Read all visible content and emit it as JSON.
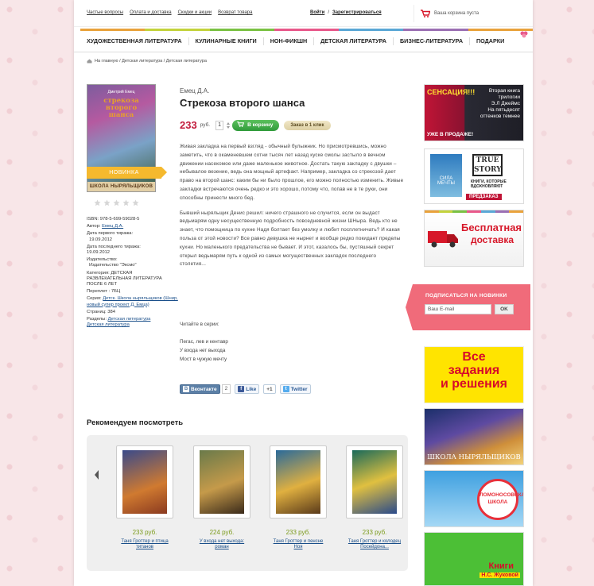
{
  "topbar": {
    "links": [
      "Частые вопросы",
      "Оплата и доставка",
      "Скидки и акции",
      "Возврат товара"
    ],
    "login": "Войти",
    "separator": "/",
    "register": "Зарегистрироваться",
    "cart_text": "Ваша корзина пуста"
  },
  "nav": {
    "items": [
      "ХУДОЖЕСТВЕННАЯ ЛИТЕРАТУРА",
      "КУЛИНАРНЫЕ КНИГИ",
      "НОН-ФИКШН",
      "ДЕТСКАЯ ЛИТЕРАТУРА",
      "БИЗНЕС-ЛИТЕРАТУРА",
      "ПОДАРКИ"
    ],
    "stripe_colors": [
      "#e9a23b",
      "#c3d33c",
      "#7ac143",
      "#e8588a",
      "#5aa7d6",
      "#9b6fb3",
      "#e9a23b"
    ]
  },
  "breadcrumb": "На главную / Детская литература / Детская литература",
  "product": {
    "cover_author": "Дмитрий Емец",
    "cover_title": "стрекоза второго шанса",
    "cover_footer": "ШКОЛА НЫРЯЛЬЩИКОВ",
    "badge": "НОВИНКА",
    "rating": 0,
    "rating_max": 5,
    "author": "Емец Д.А.",
    "title": "Стрекоза второго шанса",
    "price": "233",
    "currency": "руб.",
    "qty": "1",
    "add_to_cart": "В корзину",
    "one_click": "Заказ в 1 клик",
    "meta": {
      "isbn": "ISBN: 978-5-699-59028-5",
      "author_label": "Автор:",
      "author_link": "Емец Д.А.",
      "first_print_label": "Дата первого тиража:",
      "first_print": "19.09.2012",
      "last_print_label": "Дата последнего тиража:",
      "last_print": "19.09.2012",
      "publisher_label": "Издательство:",
      "publisher": "Издательство \"Эксмо\"",
      "category_label": "Категория:",
      "category": "ДЕТСКАЯ РАЗВЛЕКАТЕЛЬНАЯ ЛИТЕРАТУРА ПОСЛЕ 6 ЛЕТ",
      "translator": "Переплет : 7БЦ",
      "series_label": "Серия:",
      "series_link": "Детск. Школа ныряльщиков (Шнир, новый супер проект Д. Емца)",
      "pages": "Страниц: 384",
      "sections_label": "Разделы:",
      "sections_link1": "Детская литература",
      "sections_link2": "Детская литература"
    },
    "description": [
      "Живая закладка на первый взгляд - обычный булыжник. Но присмотревшись, можно заметить, что в окаменевшем сотни тысяч лет назад куске смолы застыло в вечном движении насекомое или даже маленькое животное. Достать такую закладку с двушки – небывалое везение, ведь она мощный артефакт. Например, закладка со стрекозой дает право на второй шанс: каким бы ни было прошлое, его можно полностью изменить. Живые закладки встречаются очень редко и это хорошо, потому что, попав не в те руки, они способны принести много бед.",
      "Бывший ныряльщик Денис решил: ничего страшного не случится, если он выдаст ведьмарям одну несущественную подробность повседневной жизни ШНыра. Ведь кто не знает, что помощница по кухне Надя болтает без умолку и любит посплетничать? И какая польза от этой новости? Все равно девушка не нырнет и вообще редко покидает пределы кухни. Но маленького предательства не бывает. И этот, казалось бы, пустяшный секрет открыл ведьмарям путь к одной из самых могущественных закладок последнего столетия..."
    ],
    "series_intro": "Читайте в серии:",
    "series_list": [
      "Пегас, лев и кентавр",
      "У входа нет выхода",
      "Мост в чужую мечту"
    ]
  },
  "social": {
    "vk": "Вконтакте",
    "vk_count": "2",
    "fb": "Like",
    "gplus": "+1",
    "tw": "Twitter"
  },
  "recommend": {
    "title": "Рекомендуем посмотреть",
    "items": [
      {
        "price": "233 руб.",
        "name": "Таня Гроттер и птица титанов"
      },
      {
        "price": "224 руб.",
        "name": "У входа нет выхода: роман"
      },
      {
        "price": "233 руб.",
        "name": "Таня Гроттер и пенсне Ноя"
      },
      {
        "price": "233 руб.",
        "name": "Таня Гроттер и колодец Посейдона..."
      }
    ]
  },
  "sidebar": {
    "b1": {
      "sens": "СЕНСАЦИЯ!!!",
      "trilogy": "Вторая книга трилогии",
      "author": "Э.Л Джеймс",
      "title": "На пятьдесят оттенков темнее",
      "sale": "УЖЕ В ПРОДАЖЕ!"
    },
    "b2": {
      "book": "СИЛА МЕЧТЫ",
      "ts1": "TRUE",
      "ts2": "STORY",
      "sub": "КНИГИ, КОТОРЫЕ ВДОХНОВЛЯЮТ",
      "pre": "ПРЕДЗАКАЗ"
    },
    "b3": {
      "t1": "Бесплатная",
      "t2": "доставка"
    },
    "subscribe": {
      "label": "ПОДПИСАТЬСЯ НА НОВИНКИ",
      "placeholder": "Ваш E-mail",
      "ok": "OK"
    },
    "b4": {
      "l1": "Все",
      "l2": "задания",
      "l3": "и решения"
    },
    "b5": {
      "text": "ШКОЛА НЫРЯЛЬЩИКОВ"
    },
    "b6": {
      "text": "ЛОМОНОСОВСКАЯ ШКОЛА"
    },
    "b7": {
      "k1": "Книги",
      "k2": "Н.С. Жуковой"
    }
  },
  "colors": {
    "price": "#c21a3b",
    "rec_price": "#7a9a1a",
    "link": "#1a4f8a",
    "cart_button": "#3aa63f",
    "subscribe_bg": "#f06b7a"
  }
}
